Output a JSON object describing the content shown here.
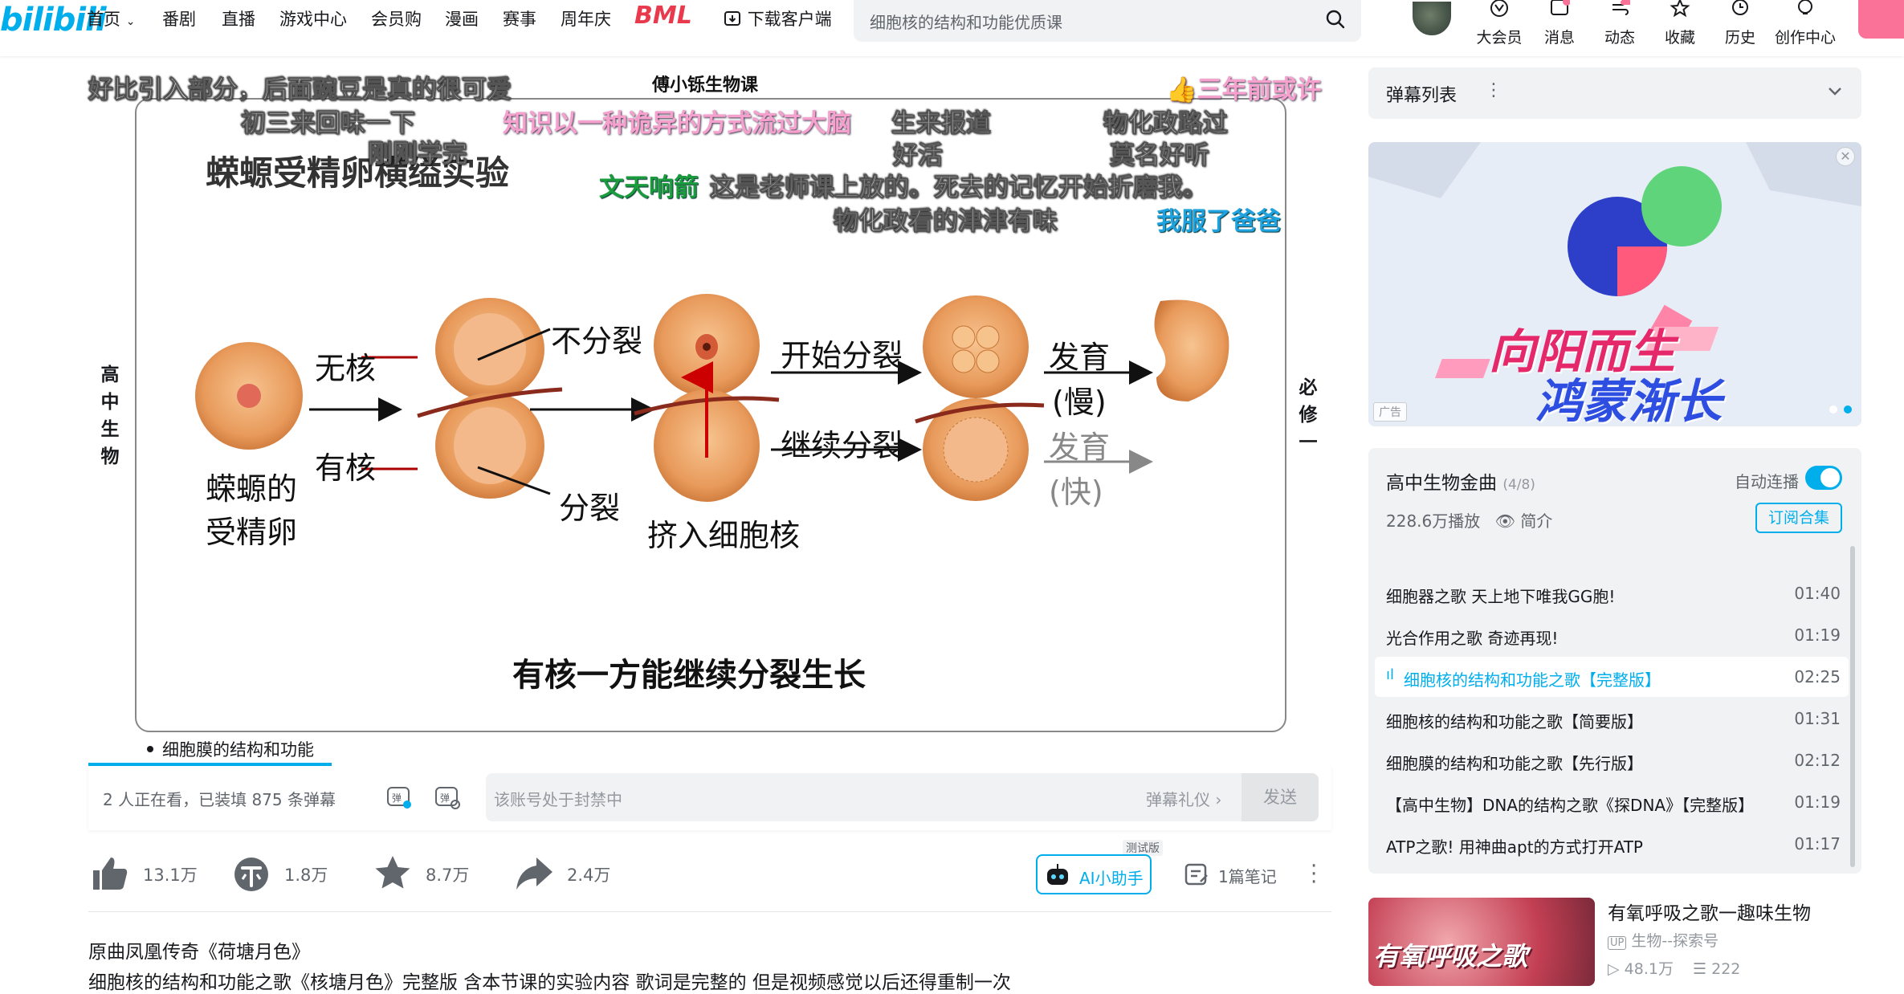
{
  "header": {
    "logo": "bilibili",
    "nav": [
      "首页",
      "番剧",
      "直播",
      "游戏中心",
      "会员购",
      "漫画",
      "赛事",
      "周年庆",
      "BML",
      "下载客户端"
    ],
    "search_placeholder": "细胞核的结构和功能优质课",
    "actions": [
      "大会员",
      "消息",
      "动态",
      "收藏",
      "历史",
      "创作中心"
    ]
  },
  "video": {
    "watermark": "傅小铄生物课",
    "slide_title": "蝾螈受精卵横缢实验",
    "labels": {
      "egg": "蝾螈的",
      "egg2": "受精卵",
      "no_nucleus": "无核",
      "has_nucleus": "有核",
      "no_split": "不分裂",
      "split": "分裂",
      "squeeze": "挤入细胞核",
      "start_split": "开始分裂",
      "continue_split": "继续分裂",
      "develop_slow1": "发育",
      "develop_slow2": "(慢)",
      "develop_fast1": "发育",
      "develop_fast2": "(快)",
      "conclusion": "有核一方能继续分裂生长",
      "left_vert": [
        "高",
        "中",
        "生",
        "物"
      ],
      "right_vert": [
        "必",
        "修",
        "一"
      ]
    },
    "danmaku": [
      {
        "text": "好比引入部分，后面豌豆是真的很可爱",
        "style": "white"
      },
      {
        "text": "三年前或许",
        "style": "pink"
      },
      {
        "text": "初三来回味一下",
        "style": "white"
      },
      {
        "text": "知识以一种诡异的方式流过大脑",
        "style": "pink"
      },
      {
        "text": "生来报道",
        "style": "white"
      },
      {
        "text": "物化政路过",
        "style": "white"
      },
      {
        "text": "刚刚学完",
        "style": "white"
      },
      {
        "text": "好活",
        "style": "white"
      },
      {
        "text": "莫名好听",
        "style": "white"
      },
      {
        "text": "文天响箭",
        "style": "green"
      },
      {
        "text": "这是老师课上放的。死去的记忆开始折磨我。",
        "style": "white"
      },
      {
        "text": "物化政看的津津有味",
        "style": "white"
      },
      {
        "text": "我服了爸爸",
        "style": "blue"
      }
    ],
    "chapter": "细胞膜的结构和功能"
  },
  "danmaku_bar": {
    "info": "2 人正在看，已装填 875 条弹幕",
    "input_placeholder": "该账号处于封禁中",
    "etiquette": "弹幕礼仪 ›",
    "send": "发送"
  },
  "toolbar": {
    "like": "13.1万",
    "coin": "1.8万",
    "favorite": "8.7万",
    "share": "2.4万",
    "ai_tag": "测试版",
    "ai": "AI小助手",
    "note": "1篇笔记"
  },
  "description": {
    "line1": "原曲凤凰传奇《荷塘月色》",
    "line2": "细胞核的结构和功能之歌《核塘月色》完整版 含本节课的实验内容 歌词是完整的 但是视频感觉以后还得重制一次"
  },
  "sidebar": {
    "danmaku_list": "弹幕列表",
    "ad_tag": "广告",
    "ad_line1": "向阳而生",
    "ad_line2": "鸿蒙渐长",
    "playlist": {
      "title": "高中生物金曲",
      "count": "(4/8)",
      "autoplay": "自动连播",
      "plays": "228.6万播放",
      "intro": "简介",
      "subscribe": "订阅合集",
      "items": [
        {
          "title": "细胞器之歌 天上地下唯我GG胞!",
          "duration": "01:40"
        },
        {
          "title": "光合作用之歌 奇迹再现!",
          "duration": "01:19"
        },
        {
          "title": "细胞核的结构和功能之歌【完整版】",
          "duration": "02:25"
        },
        {
          "title": "细胞核的结构和功能之歌【简要版】",
          "duration": "01:31"
        },
        {
          "title": "细胞膜的结构和功能之歌【先行版】",
          "duration": "02:12"
        },
        {
          "title": "【高中生物】DNA的结构之歌《探DNA》【完整版】",
          "duration": "01:19"
        },
        {
          "title": "ATP之歌! 用神曲apt的方式打开ATP",
          "duration": "01:17"
        }
      ]
    },
    "recommend": {
      "thumb_text": "有氧呼吸之歌",
      "title": "有氧呼吸之歌一趣味生物",
      "up": "生物--探索号",
      "plays": "48.1万",
      "danmaku": "222"
    }
  }
}
